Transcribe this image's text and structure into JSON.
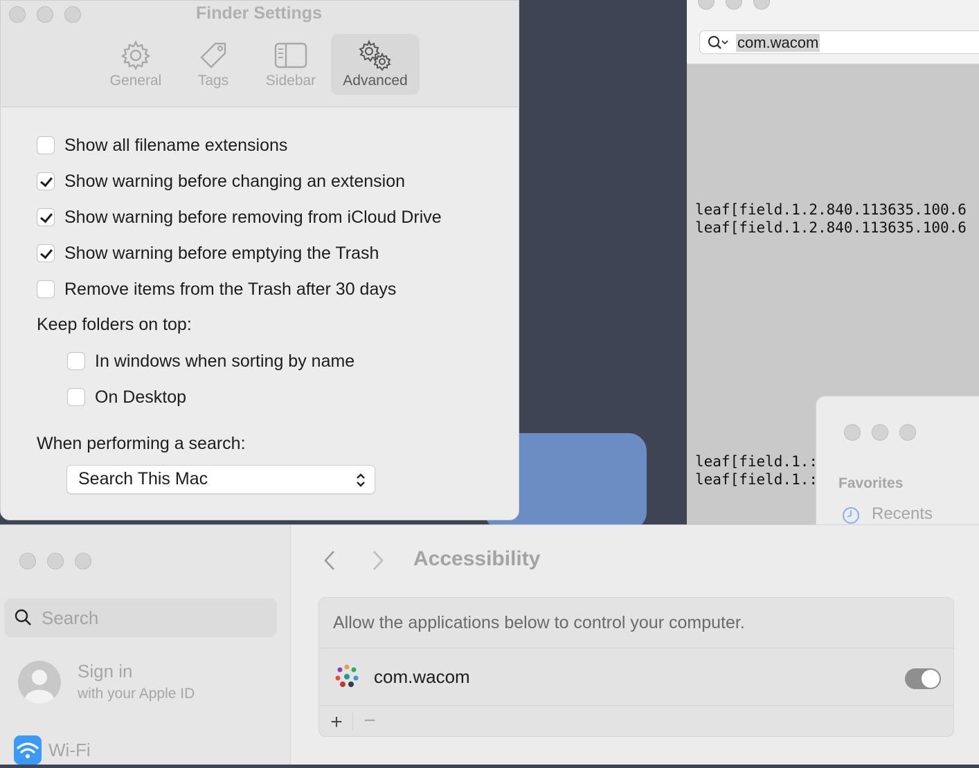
{
  "finder_settings": {
    "title": "Finder Settings",
    "tabs": [
      {
        "label": "General",
        "icon": "gear-icon"
      },
      {
        "label": "Tags",
        "icon": "tag-icon"
      },
      {
        "label": "Sidebar",
        "icon": "sidebar-icon"
      },
      {
        "label": "Advanced",
        "icon": "gears-icon",
        "selected": true
      }
    ],
    "options": [
      {
        "label": "Show all filename extensions",
        "checked": false
      },
      {
        "label": "Show warning before changing an extension",
        "checked": true
      },
      {
        "label": "Show warning before removing from iCloud Drive",
        "checked": true
      },
      {
        "label": "Show warning before emptying the Trash",
        "checked": true
      },
      {
        "label": "Remove items from the Trash after 30 days",
        "checked": false
      }
    ],
    "keep_folders_label": "Keep folders on top:",
    "keep_folders": [
      {
        "label": "In windows when sorting by name",
        "checked": false
      },
      {
        "label": "On Desktop",
        "checked": false
      }
    ],
    "search_label": "When performing a search:",
    "search_value": "Search This Mac"
  },
  "console": {
    "search_value": "com.wacom",
    "lines_top": [
      "leaf[field.1.2.840.113635.100.6",
      "leaf[field.1.2.840.113635.100.6"
    ],
    "lines_bottom": [
      "leaf[field.1.:",
      "leaf[field.1.:"
    ]
  },
  "finder_mini": {
    "favorites_label": "Favorites",
    "recents_label": "Recents"
  },
  "system_settings": {
    "search_placeholder": "Search",
    "sign_in": "Sign in",
    "sign_in_sub": "with your Apple ID",
    "wifi": "Wi-Fi",
    "title": "Accessibility",
    "description": "Allow the applications below to control your computer.",
    "app_name": "com.wacom",
    "toggle_on": false,
    "plus": "+",
    "minus": "−"
  }
}
